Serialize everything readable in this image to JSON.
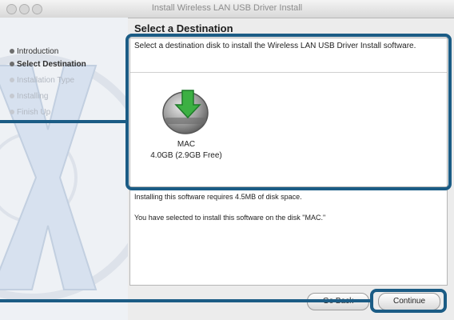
{
  "window": {
    "title": "Install Wireless LAN USB Driver Install"
  },
  "sidebar": {
    "steps": [
      {
        "label": "Introduction",
        "state": "done"
      },
      {
        "label": "Select Destination",
        "state": "current"
      },
      {
        "label": "Installation Type",
        "state": "pending"
      },
      {
        "label": "Installing",
        "state": "pending"
      },
      {
        "label": "Finish Up",
        "state": "pending"
      }
    ]
  },
  "main": {
    "heading": "Select a Destination",
    "instruction": "Select a destination disk to install the Wireless LAN USB Driver Install software.",
    "disk": {
      "name": "MAC",
      "space": "4.0GB (2.9GB Free)",
      "icon": "hard-disk-icon"
    },
    "info": {
      "requirement": "Installing this software requires 4.5MB of disk space.",
      "selection": "You have selected to install this software on the disk \"MAC.\""
    }
  },
  "buttons": {
    "go_back": "Go Back",
    "continue": "Continue"
  },
  "colors": {
    "highlight": "#1b5c85",
    "download_arrow": "#3cb043"
  }
}
